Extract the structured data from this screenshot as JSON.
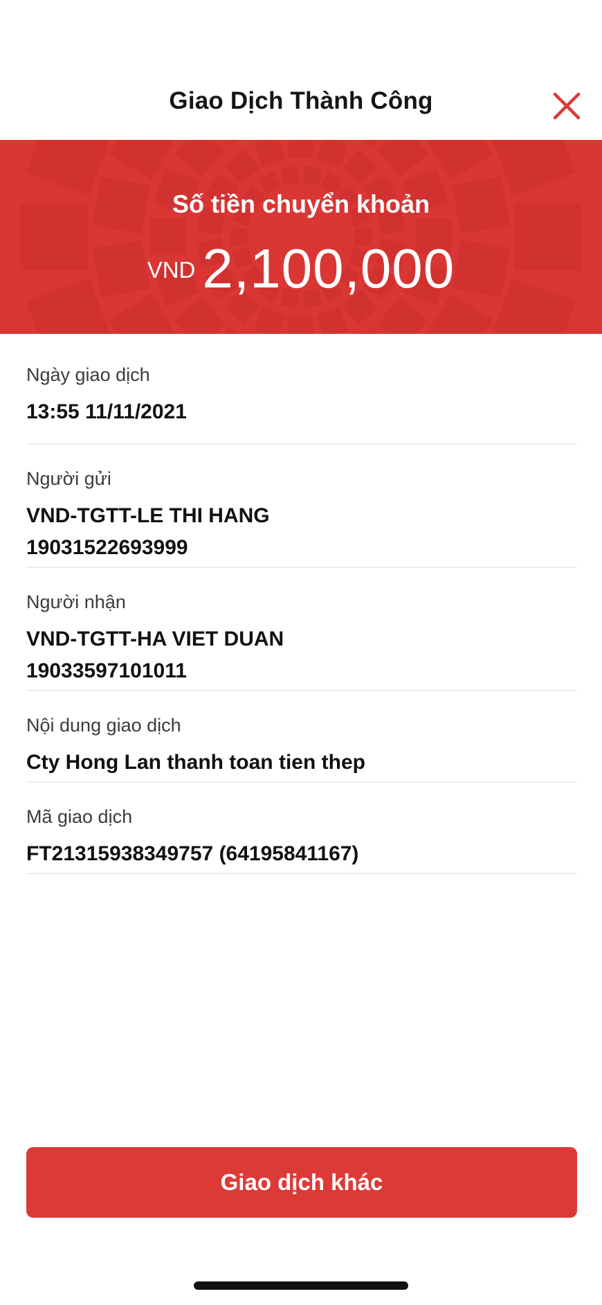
{
  "header": {
    "title": "Giao Dịch Thành Công",
    "close_icon": "close-icon"
  },
  "banner": {
    "label": "Số tiền chuyển khoản",
    "currency": "VND",
    "amount": "2,100,000",
    "background_color": "#d93634"
  },
  "details": [
    {
      "label": "Ngày giao dịch",
      "value_lines": [
        "13:55 11/11/2021"
      ]
    },
    {
      "label": "Người gửi",
      "value_lines": [
        "VND-TGTT-LE THI HANG",
        "19031522693999"
      ]
    },
    {
      "label": "Người nhận",
      "value_lines": [
        "VND-TGTT-HA VIET DUAN",
        "19033597101011"
      ]
    },
    {
      "label": "Nội dung giao dịch",
      "value_lines": [
        "Cty Hong Lan thanh toan tien thep"
      ]
    },
    {
      "label": "Mã giao dịch",
      "value_lines": [
        "FT21315938349757 (64195841167)"
      ]
    }
  ],
  "actions": {
    "primary_label": "Giao dịch khác",
    "primary_color": "#dc3a37"
  }
}
